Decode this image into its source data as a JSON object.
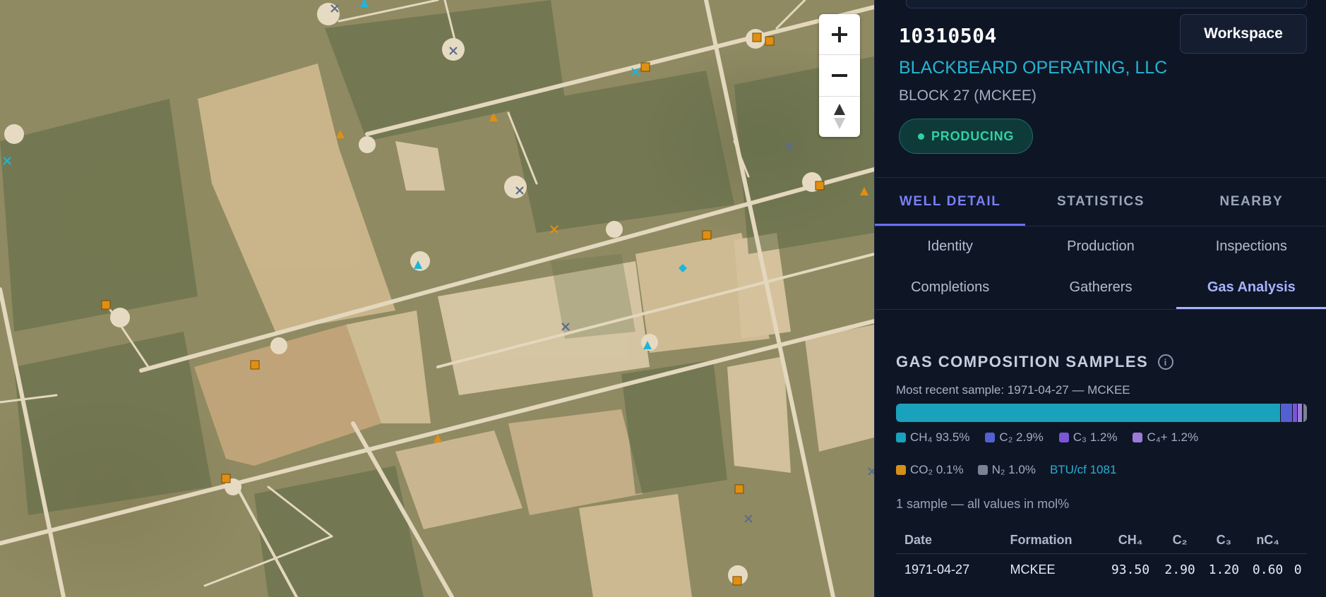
{
  "map": {
    "zoom_in_label": "+",
    "zoom_out_label": "−",
    "markers": [
      {
        "type": "x",
        "color": "#5b6c8c"
      },
      {
        "type": "triangle",
        "color": "#1fb5d6"
      },
      {
        "type": "x",
        "color": "#5b6c8c"
      },
      {
        "type": "square",
        "color": "#e08f12"
      },
      {
        "type": "square",
        "color": "#e08f12"
      },
      {
        "type": "x",
        "color": "#1fb5d6"
      },
      {
        "type": "square",
        "color": "#e08f12"
      },
      {
        "type": "triangle",
        "color": "#e08f12"
      },
      {
        "type": "triangle",
        "color": "#e08f12"
      },
      {
        "type": "x",
        "color": "#1fb5d6"
      },
      {
        "type": "x",
        "color": "#5b6c8c"
      },
      {
        "type": "x",
        "color": "#e08f12"
      },
      {
        "type": "square",
        "color": "#e08f12"
      },
      {
        "type": "triangle",
        "color": "#e08f12"
      },
      {
        "type": "x",
        "color": "#5b6c8c"
      },
      {
        "type": "square",
        "color": "#e08f12"
      },
      {
        "type": "triangle",
        "color": "#1fb5d6"
      },
      {
        "type": "diamond",
        "color": "#1fb5d6"
      },
      {
        "type": "square",
        "color": "#e08f12"
      },
      {
        "type": "x",
        "color": "#5b6c8c"
      },
      {
        "type": "triangle",
        "color": "#1fb5d6"
      },
      {
        "type": "square",
        "color": "#e08f12"
      },
      {
        "type": "triangle",
        "color": "#e08f12"
      },
      {
        "type": "square",
        "color": "#e08f12"
      },
      {
        "type": "square",
        "color": "#e08f12"
      },
      {
        "type": "x",
        "color": "#5b6c8c"
      },
      {
        "type": "square",
        "color": "#e08f12"
      },
      {
        "type": "x",
        "color": "#5b6c8c"
      }
    ]
  },
  "well": {
    "id": "10310504",
    "operator": "BLACKBEARD OPERATING, LLC",
    "lease": "BLOCK 27 (MCKEE)",
    "status": "PRODUCING",
    "status_color": "#2ed3a2"
  },
  "workspace_label": "Workspace",
  "main_tabs": [
    {
      "label": "WELL DETAIL",
      "active": true
    },
    {
      "label": "STATISTICS",
      "active": false
    },
    {
      "label": "NEARBY",
      "active": false
    }
  ],
  "sub_tabs": [
    {
      "label": "Identity",
      "active": false
    },
    {
      "label": "Production",
      "active": false
    },
    {
      "label": "Inspections",
      "active": false
    },
    {
      "label": "Completions",
      "active": false
    },
    {
      "label": "Gatherers",
      "active": false
    },
    {
      "label": "Gas Analysis",
      "active": true
    }
  ],
  "gas": {
    "title": "GAS COMPOSITION SAMPLES",
    "info_icon": "i",
    "recent": "Most recent sample: 1971-04-27 — MCKEE",
    "components": [
      {
        "label": "CH₄ 93.5%",
        "pct": 93.5,
        "color": "#1aa1bb"
      },
      {
        "label": "C₂ 2.9%",
        "pct": 2.9,
        "color": "#5560d0"
      },
      {
        "label": "C₃ 1.2%",
        "pct": 1.2,
        "color": "#7a56d6"
      },
      {
        "label": "C₄+ 1.2%",
        "pct": 1.2,
        "color": "#9d7ad8"
      },
      {
        "label": "CO₂ 0.1%",
        "pct": 0.1,
        "color": "#d68f17"
      },
      {
        "label": "N₂ 1.0%",
        "pct": 1.0,
        "color": "#7a8395"
      }
    ],
    "btu": "BTU/cf 1081",
    "sample_note": "1 sample — all values in mol%",
    "table": {
      "headers": [
        "Date",
        "Formation",
        "CH₄",
        "C₂",
        "C₃",
        "nC₄"
      ],
      "rows": [
        {
          "date": "1971-04-27",
          "formation": "MCKEE",
          "ch4": "93.50",
          "c2": "2.90",
          "c3": "1.20",
          "nc4": "0.60",
          "more": "0"
        }
      ]
    }
  }
}
